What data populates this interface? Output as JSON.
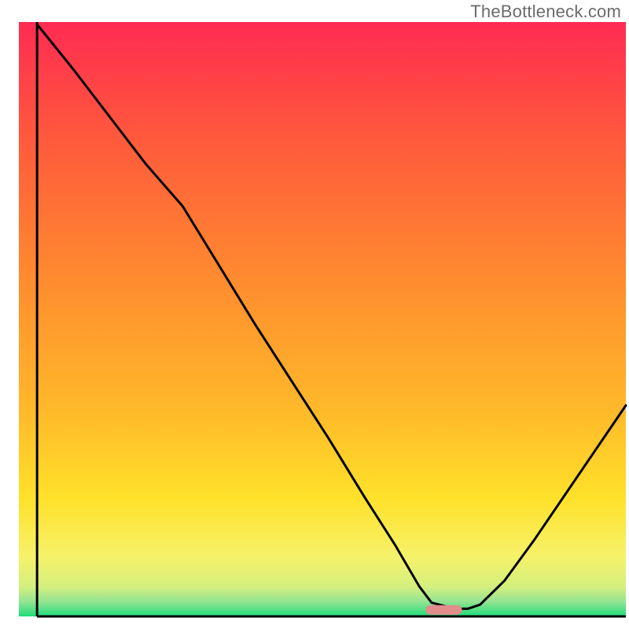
{
  "watermark": "TheBottleneck.com",
  "chart_data": {
    "type": "line",
    "title": "",
    "xlabel": "",
    "ylabel": "",
    "xlim": [
      0,
      100
    ],
    "ylim": [
      0,
      100
    ],
    "grid": false,
    "legend": false,
    "series": [
      {
        "name": "curve",
        "x": [
          3,
          9,
          15,
          21,
          27,
          33,
          39,
          45,
          51,
          57,
          62,
          66,
          68,
          72,
          74,
          76,
          80,
          85,
          90,
          95,
          100
        ],
        "y": [
          99.6,
          92,
          84,
          76,
          69,
          59,
          49,
          39.5,
          30,
          20,
          12,
          5,
          2.3,
          1.3,
          1.3,
          2,
          6,
          13,
          20.5,
          28,
          35.5
        ]
      }
    ],
    "marker": {
      "shape": "rounded-rect",
      "color": "#e28c8c",
      "x_center": 70,
      "y": 1.1,
      "width_x_units": 6,
      "height_y_units": 1.6
    },
    "gradient_stops": [
      {
        "offset": 0.0,
        "color": "#ff2b52"
      },
      {
        "offset": 0.2,
        "color": "#ff5a3c"
      },
      {
        "offset": 0.45,
        "color": "#ff8f2e"
      },
      {
        "offset": 0.65,
        "color": "#ffb82a"
      },
      {
        "offset": 0.8,
        "color": "#ffe12a"
      },
      {
        "offset": 0.9,
        "color": "#f6f26a"
      },
      {
        "offset": 0.95,
        "color": "#d4ef7e"
      },
      {
        "offset": 0.975,
        "color": "#94e493"
      },
      {
        "offset": 1.0,
        "color": "#1edc7a"
      }
    ],
    "axes": {
      "left": {
        "x": 3,
        "y0": 0,
        "y1": 100
      },
      "bottom": {
        "y": 0,
        "x0": 3,
        "x1": 100
      }
    }
  }
}
